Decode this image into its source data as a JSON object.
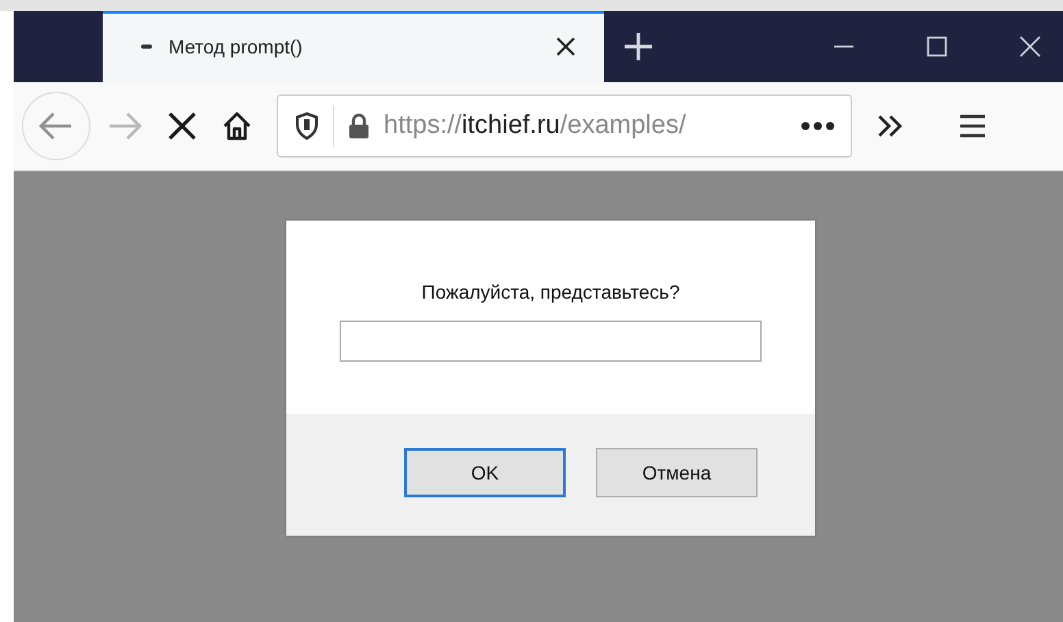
{
  "tabs": [
    {
      "title": "Метод prompt()",
      "selected": true,
      "loading": true
    }
  ],
  "toolbar": {
    "back_disabled": false,
    "forward_disabled": true,
    "loading": true
  },
  "url": {
    "scheme": "https://",
    "domain": "itchief.ru",
    "path": "/examples/"
  },
  "dialog": {
    "message": "Пожалуйста, представьтесь?",
    "buttons": [
      {
        "label": "OK",
        "focused": true
      },
      {
        "label": "Отмена",
        "focused": false
      }
    ]
  }
}
